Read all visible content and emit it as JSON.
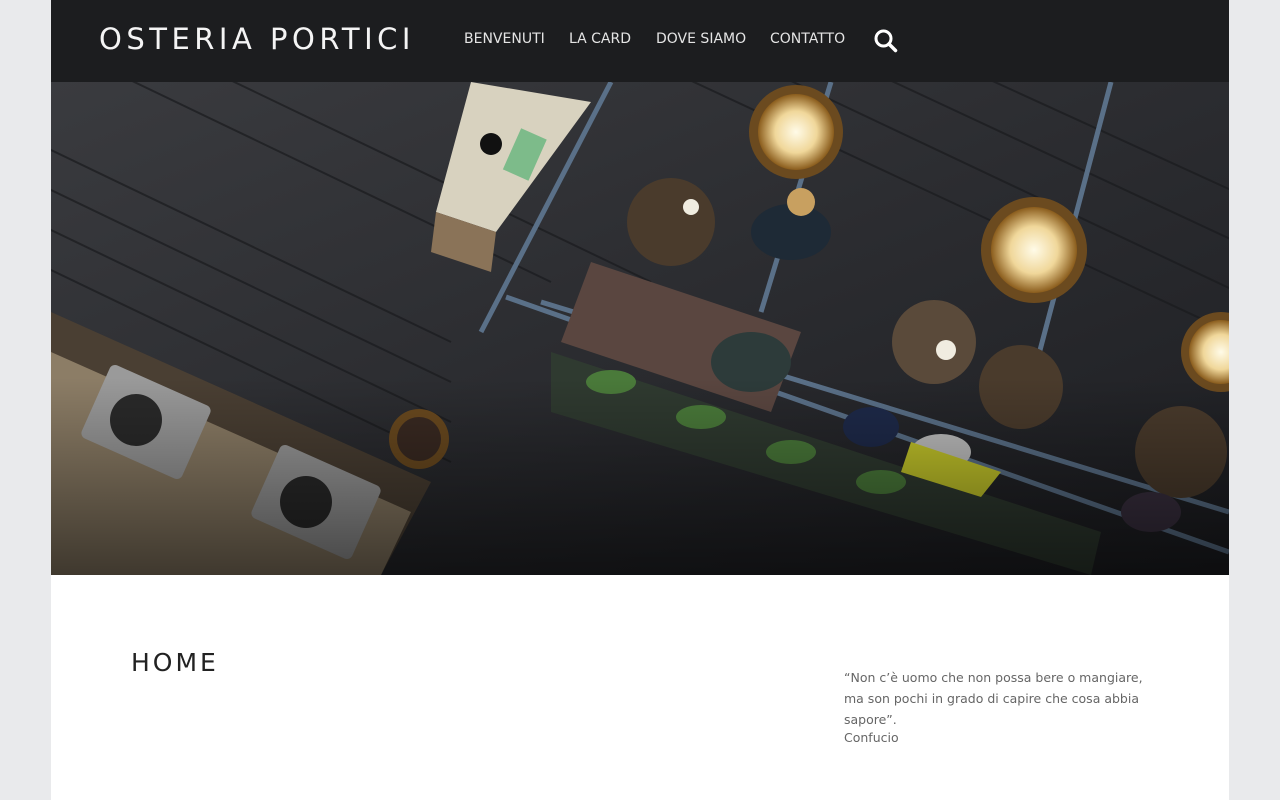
{
  "header": {
    "site_title": "OSTERIA PORTICI",
    "nav": [
      {
        "label": "BENVENUTI"
      },
      {
        "label": "LA CARD"
      },
      {
        "label": "DOVE SIAMO"
      },
      {
        "label": "CONTATTO"
      }
    ],
    "search_icon": "search-icon"
  },
  "hero": {
    "image": "restaurant-overhead-photo"
  },
  "main": {
    "title": "HOME"
  },
  "sidebar": {
    "quote": "“Non c’è uomo che non possa bere o mangiare, ma son pochi in grado di capire che cosa abbia sapore”.",
    "author": "Confucio"
  },
  "colors": {
    "header_bg": "#1c1d1f",
    "page_bg": "#e9eaec",
    "nav_text": "#e4e4e4"
  }
}
